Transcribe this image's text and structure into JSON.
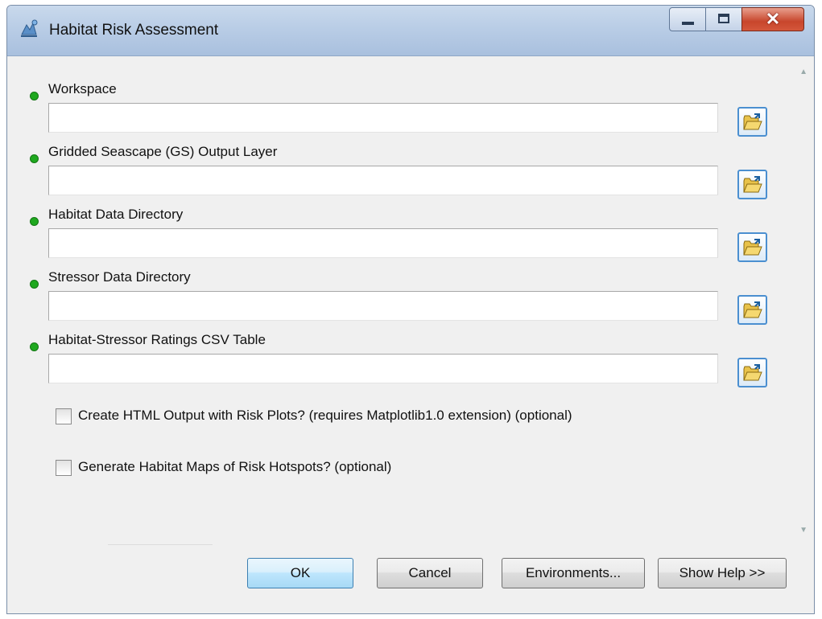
{
  "window": {
    "title": "Habitat Risk Assessment"
  },
  "parameters": [
    {
      "label": "Workspace",
      "value": "",
      "required": true
    },
    {
      "label": "Gridded Seascape (GS) Output Layer",
      "value": "",
      "required": true
    },
    {
      "label": "Habitat Data Directory",
      "value": "",
      "required": true
    },
    {
      "label": "Stressor Data Directory",
      "value": "",
      "required": true
    },
    {
      "label": "Habitat-Stressor Ratings CSV Table",
      "value": "",
      "required": true
    }
  ],
  "options": [
    {
      "label": "Create HTML Output with Risk Plots? (requires Matplotlib1.0 extension) (optional)",
      "checked": false
    },
    {
      "label": "Generate Habitat Maps of Risk Hotspots? (optional)",
      "checked": false
    }
  ],
  "buttons": {
    "ok": "OK",
    "cancel": "Cancel",
    "environments": "Environments...",
    "show_help": "Show Help >>"
  },
  "icons": {
    "app": "toolbox-icon",
    "browse": "open-folder-icon",
    "required": "green-dot-icon"
  },
  "colors": {
    "required_dot": "#1fa81f",
    "close_button": "#c8462c",
    "default_button": "#bee6fd"
  }
}
